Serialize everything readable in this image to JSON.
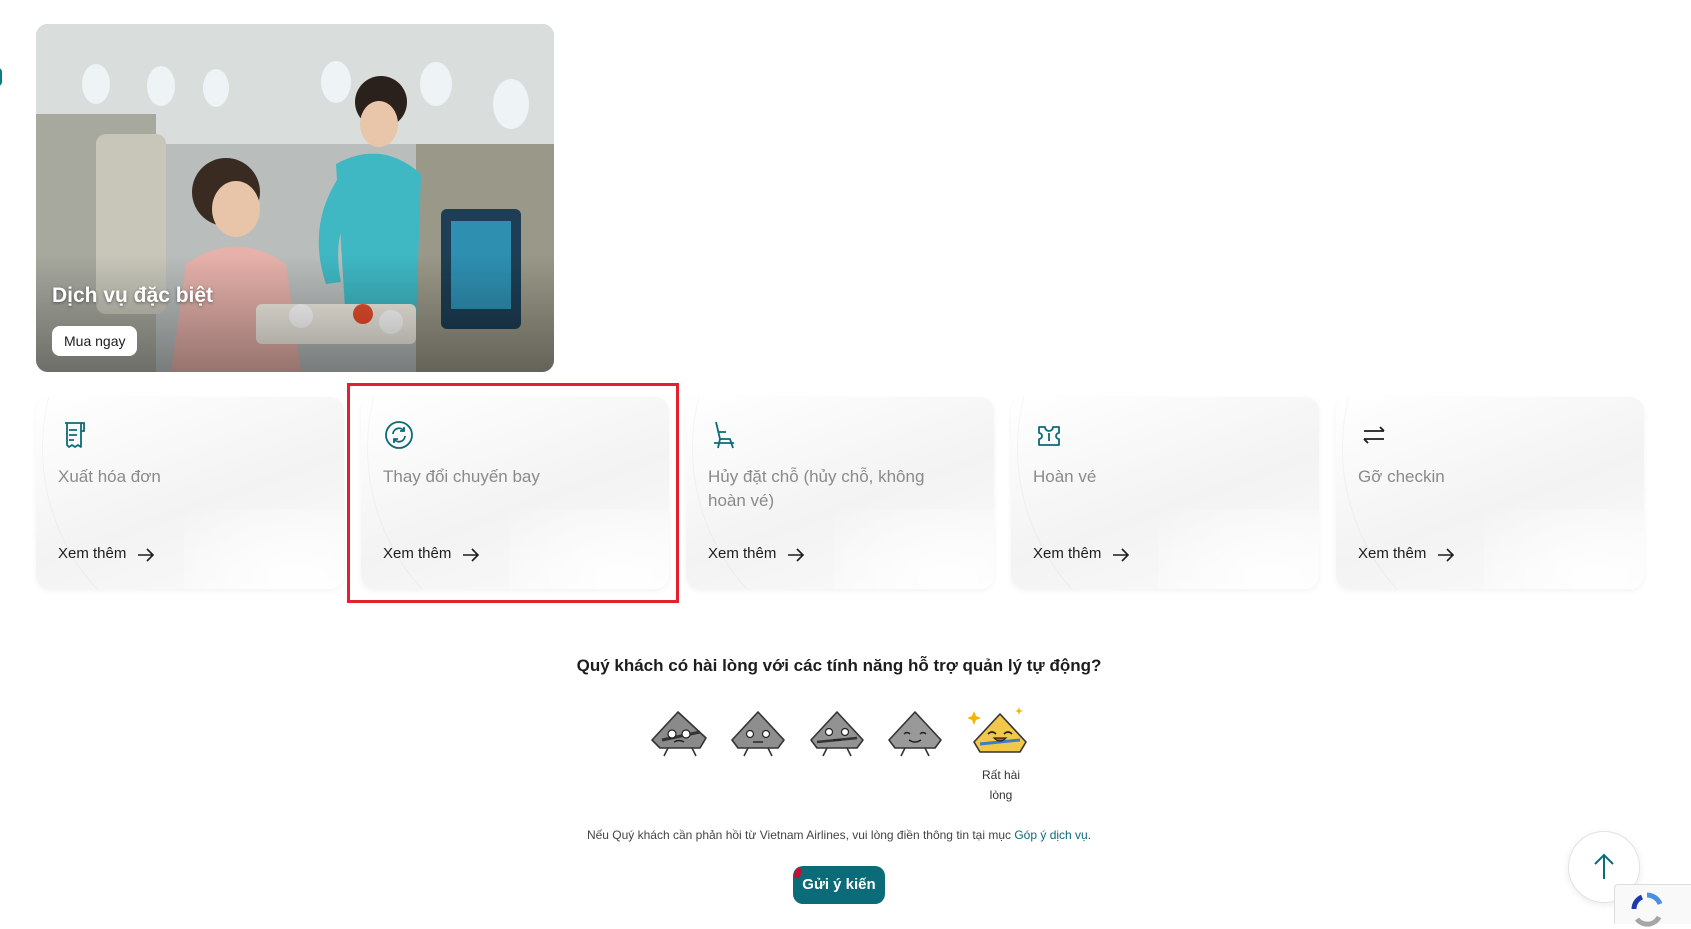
{
  "promo": {
    "title": "Dịch vụ đặc biệt",
    "button": "Mua ngay"
  },
  "services": [
    {
      "title": "Xuất hóa đơn",
      "more": "Xem thêm",
      "icon": "receipt-icon"
    },
    {
      "title": "Thay đổi chuyến bay",
      "more": "Xem thêm",
      "icon": "refresh-icon"
    },
    {
      "title": "Hủy đặt chỗ (hủy chỗ, không hoàn vé)",
      "more": "Xem thêm",
      "icon": "seat-icon"
    },
    {
      "title": "Hoàn vé",
      "more": "Xem thêm",
      "icon": "ticket-return-icon"
    },
    {
      "title": "Gỡ checkin",
      "more": "Xem thêm",
      "icon": "swap-arrows-icon"
    }
  ],
  "survey": {
    "question": "Quý khách có hài lòng với các tính năng hỗ trợ quản lý tự động?",
    "selected_label_line1": "Rất hài",
    "selected_label_line2": "lòng",
    "note_text": "Nếu Quý khách cần phản hồi từ Vietnam Airlines, vui lòng điền thông tin tại mục ",
    "note_link": "Góp ý dịch vụ",
    "note_end": ".",
    "send_button": "Gửi ý kiến"
  },
  "colors": {
    "accent": "#0b6b78",
    "highlight": "#e4202f",
    "icon": "#0b6b78"
  }
}
